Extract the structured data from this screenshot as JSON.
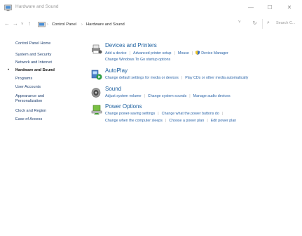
{
  "window": {
    "title": "Hardware and Sound",
    "min_glyph": "—",
    "max_glyph": "☐",
    "close_glyph": "✕"
  },
  "nav": {
    "back_glyph": "←",
    "forward_glyph": "→",
    "recent_glyph": "˅",
    "up_glyph": "↑",
    "breadcrumb": [
      "Control Panel",
      "Hardware and Sound"
    ],
    "breadcrumb_sep": "›",
    "dropdown_glyph": "˅",
    "refresh_glyph": "↻",
    "search_glyph": "⌕",
    "search_placeholder": "Search C..."
  },
  "sidebar": {
    "items": [
      {
        "label": "Control Panel Home",
        "active": false
      },
      {
        "label": "System and Security",
        "active": false
      },
      {
        "label": "Network and Internet",
        "active": false
      },
      {
        "label": "Hardware and Sound",
        "active": true
      },
      {
        "label": "Programs",
        "active": false
      },
      {
        "label": "User Accounts",
        "active": false
      },
      {
        "label": "Appearance and Personalization",
        "active": false
      },
      {
        "label": "Clock and Region",
        "active": false
      },
      {
        "label": "Ease of Access",
        "active": false
      }
    ],
    "bullet": "•"
  },
  "categories": [
    {
      "title": "Devices and Printers",
      "icon": "printer-icon",
      "lines": [
        [
          "Add a device",
          "Advanced printer setup",
          "Mouse",
          "Device Manager"
        ],
        [
          "Change Windows To Go startup options"
        ]
      ]
    },
    {
      "title": "AutoPlay",
      "icon": "autoplay-icon",
      "lines": [
        [
          "Change default settings for media or devices",
          "Play CDs or other media automatically"
        ]
      ]
    },
    {
      "title": "Sound",
      "icon": "speaker-icon",
      "lines": [
        [
          "Adjust system volume",
          "Change system sounds",
          "Manage audio devices"
        ]
      ]
    },
    {
      "title": "Power Options",
      "icon": "power-options-icon",
      "lines": [
        [
          "Change power-saving settings",
          "Change what the power buttons do"
        ],
        [
          "Change when the computer sleeps",
          "Choose a power plan",
          "Edit power plan"
        ]
      ]
    }
  ]
}
